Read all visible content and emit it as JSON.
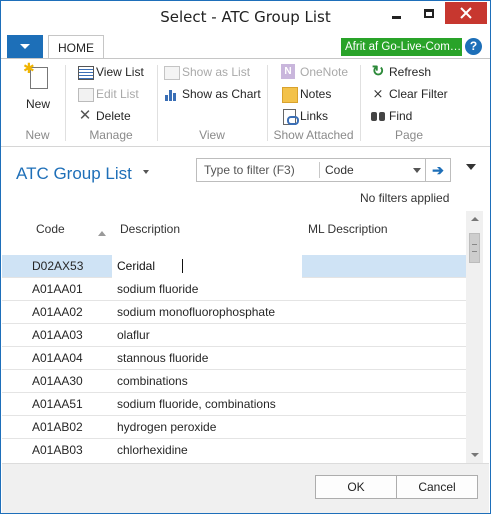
{
  "window": {
    "title": "Select - ATC Group List"
  },
  "ribbon": {
    "home_tab": "HOME",
    "company": "Afrit af Go-Live-Com…",
    "help": "?",
    "groups": {
      "new": {
        "label": "New",
        "new_button": "New"
      },
      "manage": {
        "label": "Manage",
        "view_list": "View List",
        "edit_list": "Edit List",
        "delete": "Delete"
      },
      "view": {
        "label": "View",
        "show_as_list": "Show as List",
        "show_as_chart": "Show as Chart"
      },
      "show_attached": {
        "label": "Show Attached",
        "onenote": "OneNote",
        "notes": "Notes",
        "links": "Links"
      },
      "page": {
        "label": "Page",
        "refresh": "Refresh",
        "clear_filter": "Clear Filter",
        "find": "Find"
      }
    }
  },
  "page": {
    "title": "ATC Group List",
    "filter_placeholder": "Type to filter (F3)",
    "filter_field": "Code",
    "filter_status": "No filters applied"
  },
  "grid": {
    "columns": [
      "Code",
      "Description",
      "ML Description"
    ],
    "rows": [
      {
        "code": "D02AX53",
        "description": "Ceridal",
        "ml_description": ""
      },
      {
        "code": "A01AA01",
        "description": "sodium fluoride",
        "ml_description": ""
      },
      {
        "code": "A01AA02",
        "description": "sodium monofluorophosphate",
        "ml_description": ""
      },
      {
        "code": "A01AA03",
        "description": "olaflur",
        "ml_description": ""
      },
      {
        "code": "A01AA04",
        "description": "stannous fluoride",
        "ml_description": ""
      },
      {
        "code": "A01AA30",
        "description": "combinations",
        "ml_description": ""
      },
      {
        "code": "A01AA51",
        "description": "sodium fluoride, combinations",
        "ml_description": ""
      },
      {
        "code": "A01AB02",
        "description": "hydrogen peroxide",
        "ml_description": ""
      },
      {
        "code": "A01AB03",
        "description": "chlorhexidine",
        "ml_description": ""
      }
    ]
  },
  "dialog": {
    "ok": "OK",
    "cancel": "Cancel"
  },
  "colors": {
    "accent": "#1e6fb8",
    "company_badge": "#29a329",
    "close_button": "#c7372f",
    "selected_row": "#cfe3f5"
  },
  "icons": {
    "new": "new-document-icon",
    "view_list": "list-icon",
    "edit_list": "edit-list-icon",
    "delete": "delete-x-icon",
    "show_as_list": "list-icon",
    "show_as_chart": "chart-icon",
    "onenote": "onenote-icon",
    "notes": "notes-icon",
    "links": "links-icon",
    "refresh": "refresh-icon",
    "clear_filter": "clear-filter-icon",
    "find": "binoculars-icon"
  }
}
